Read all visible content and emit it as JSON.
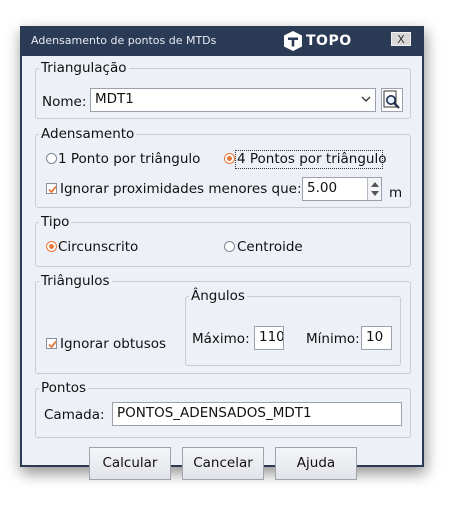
{
  "window": {
    "title": "Adensamento de pontos de MTDs",
    "logo_text": "TOPO",
    "close_label": "X"
  },
  "triangulacao": {
    "group_label": "Triangulação",
    "nome_label": "Nome:",
    "nome_value": "MDT1"
  },
  "adensamento": {
    "group_label": "Adensamento",
    "option1_label": "1 Ponto por triângulo",
    "option2_label": "4 Pontos por triângulo",
    "selected_option": "4 Pontos por triângulo",
    "ignorar_label": "Ignorar proximidades menores que:",
    "ignorar_checked": true,
    "distance_value": "5.00",
    "unit": "m"
  },
  "tipo": {
    "group_label": "Tipo",
    "option1_label": "Circunscrito",
    "option2_label": "Centroide",
    "selected_option": "Circunscrito"
  },
  "triangulos": {
    "group_label": "Triângulos",
    "ignorar_obtusos_label": "Ignorar obtusos",
    "ignorar_obtusos_checked": true,
    "angulos_label": "Ângulos",
    "maximo_label": "Máximo:",
    "maximo_value": "110",
    "minimo_label": "Mínimo:",
    "minimo_value": "10"
  },
  "pontos": {
    "group_label": "Pontos",
    "camada_label": "Camada:",
    "camada_value": "PONTOS_ADENSADOS_MDT1"
  },
  "buttons": {
    "calcular": "Calcular",
    "cancelar": "Cancelar",
    "ajuda": "Ajuda"
  },
  "colors": {
    "titlebar": "#2b3a55",
    "client_bg": "#eef0f7",
    "radio_accent": "#e8783a"
  }
}
